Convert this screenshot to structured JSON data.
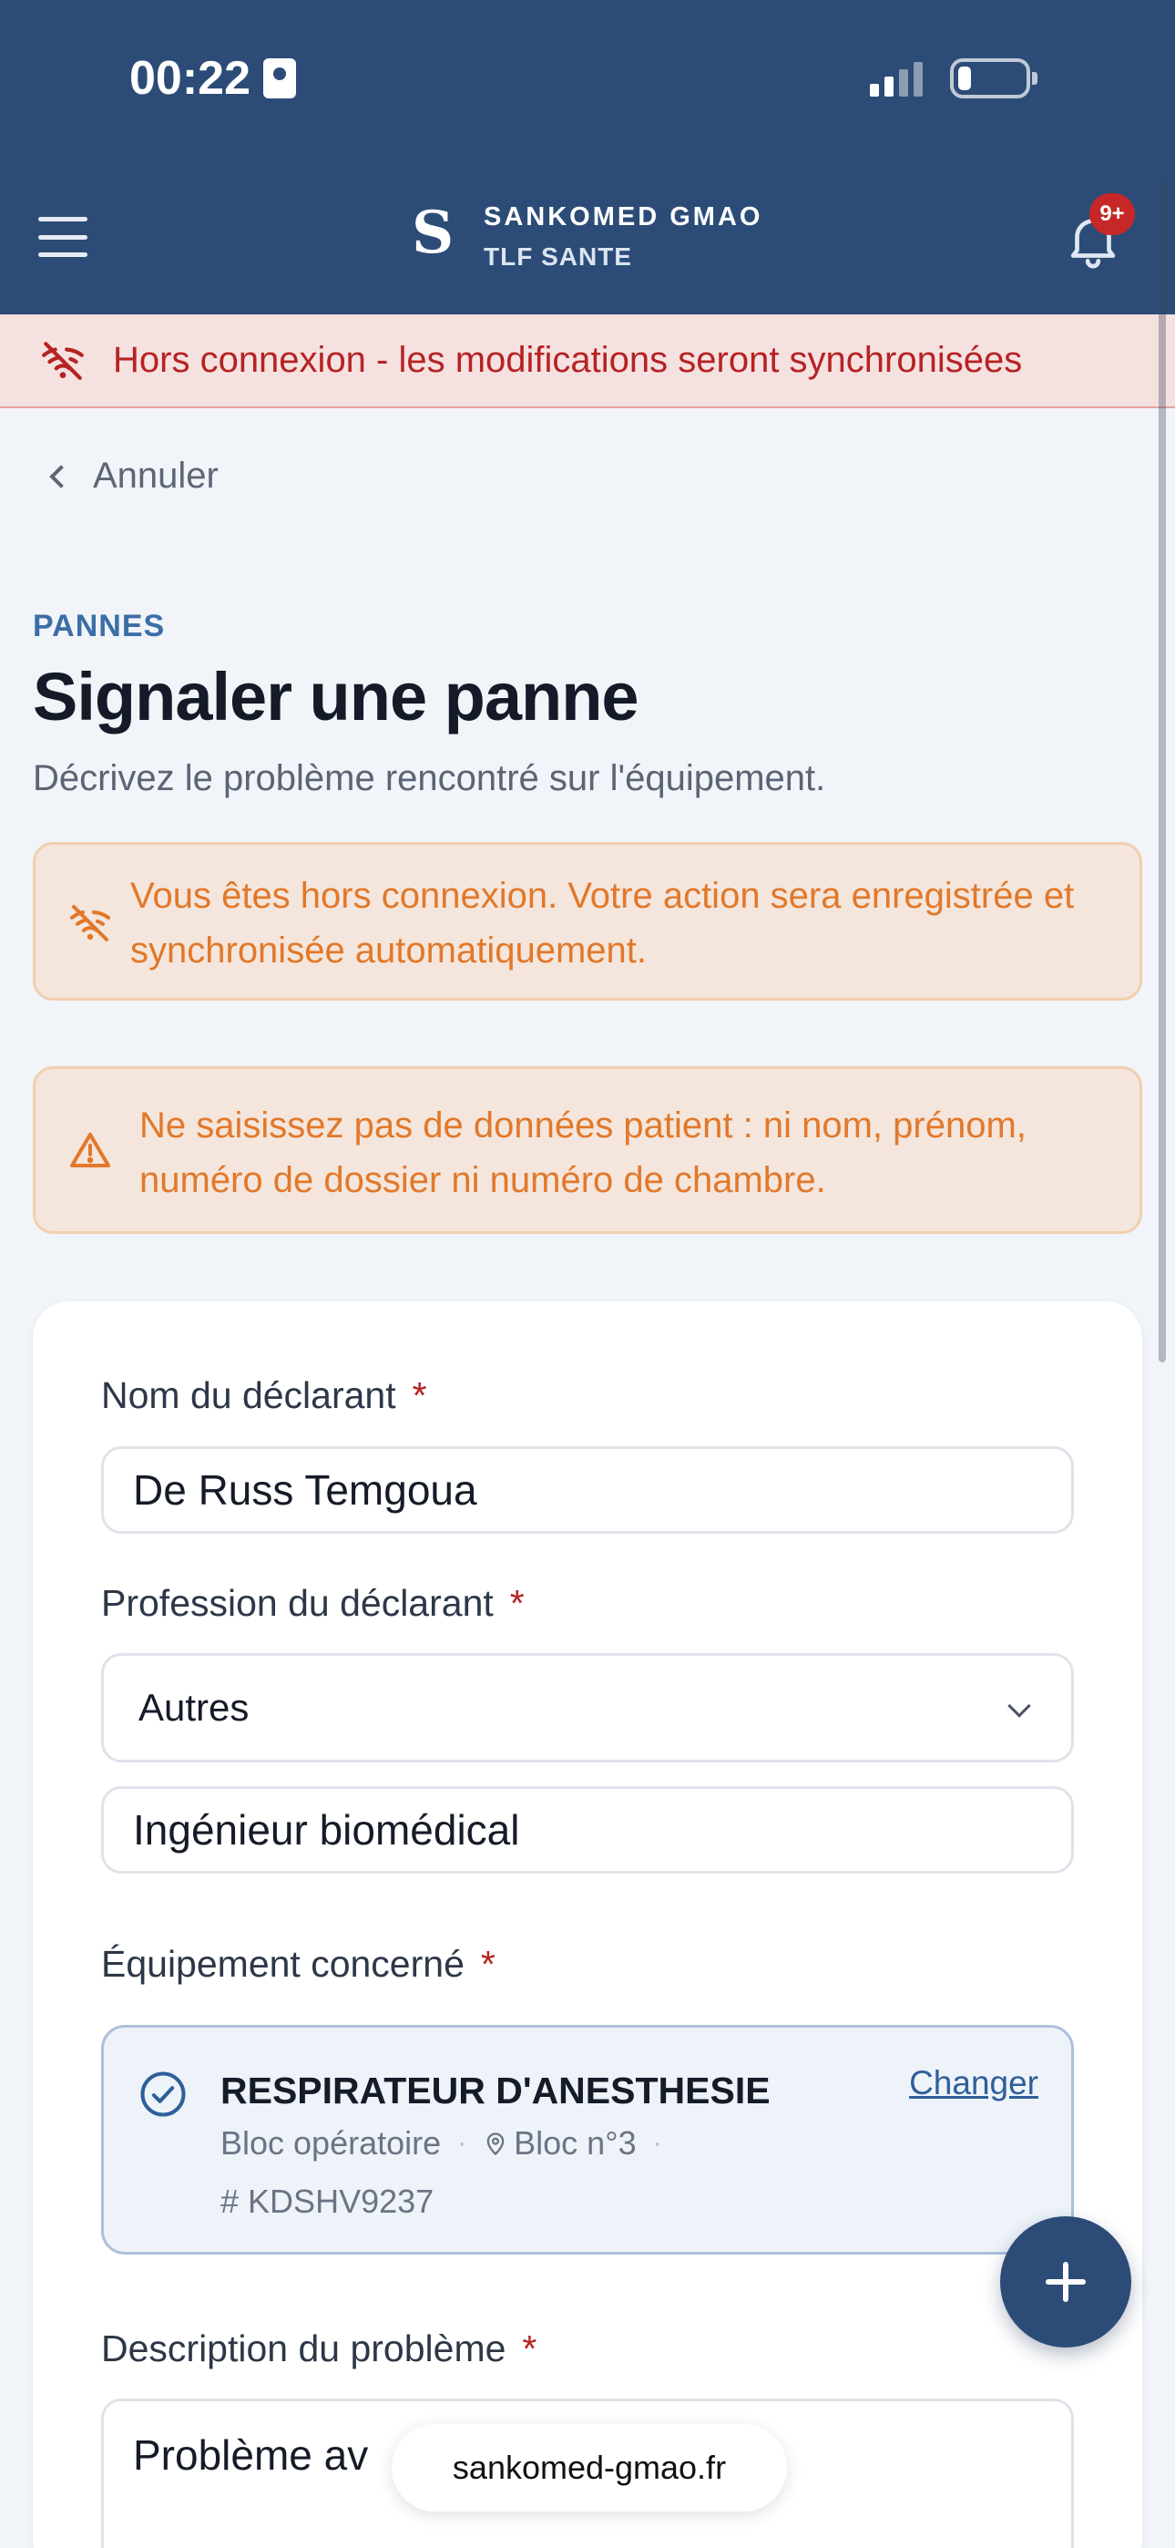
{
  "status_bar": {
    "time": "00:22"
  },
  "header": {
    "logo_letter": "S",
    "brand_name": "SANKOMED GMAO",
    "brand_sub": "TLF SANTE",
    "notification_badge": "9+"
  },
  "offline_banner": {
    "text": "Hors connexion - les modifications seront synchronisées"
  },
  "back": {
    "label": "Annuler"
  },
  "page": {
    "section": "PANNES",
    "title": "Signaler une panne",
    "subtitle": "Décrivez le problème rencontré sur l'équipement."
  },
  "alerts": {
    "offline": "Vous êtes hors connexion. Votre action sera enregistrée et synchronisée automatiquement.",
    "privacy": "Ne saisissez pas de données patient : ni nom, prénom, numéro de dossier ni numéro de chambre."
  },
  "form": {
    "required_marker": "*",
    "declarant_label": "Nom du déclarant",
    "declarant_value": "De Russ Temgoua",
    "profession_label": "Profession du déclarant",
    "profession_select": "Autres",
    "profession_other_value": "Ingénieur biomédical",
    "equipment_label": "Équipement concerné",
    "equipment": {
      "name": "RESPIRATEUR D'ANESTHESIE",
      "change_label": "Changer",
      "service": "Bloc opératoire",
      "location": "Bloc n°3",
      "reference": "KDSHV9237"
    },
    "description_label": "Description du problème",
    "description_value": "Problème av"
  },
  "browser": {
    "url": "sankomed-gmao.fr"
  },
  "colors": {
    "primary": "#2c4c77",
    "danger": "#b62323",
    "warning": "#e2782a",
    "link": "#2f5f9a"
  }
}
